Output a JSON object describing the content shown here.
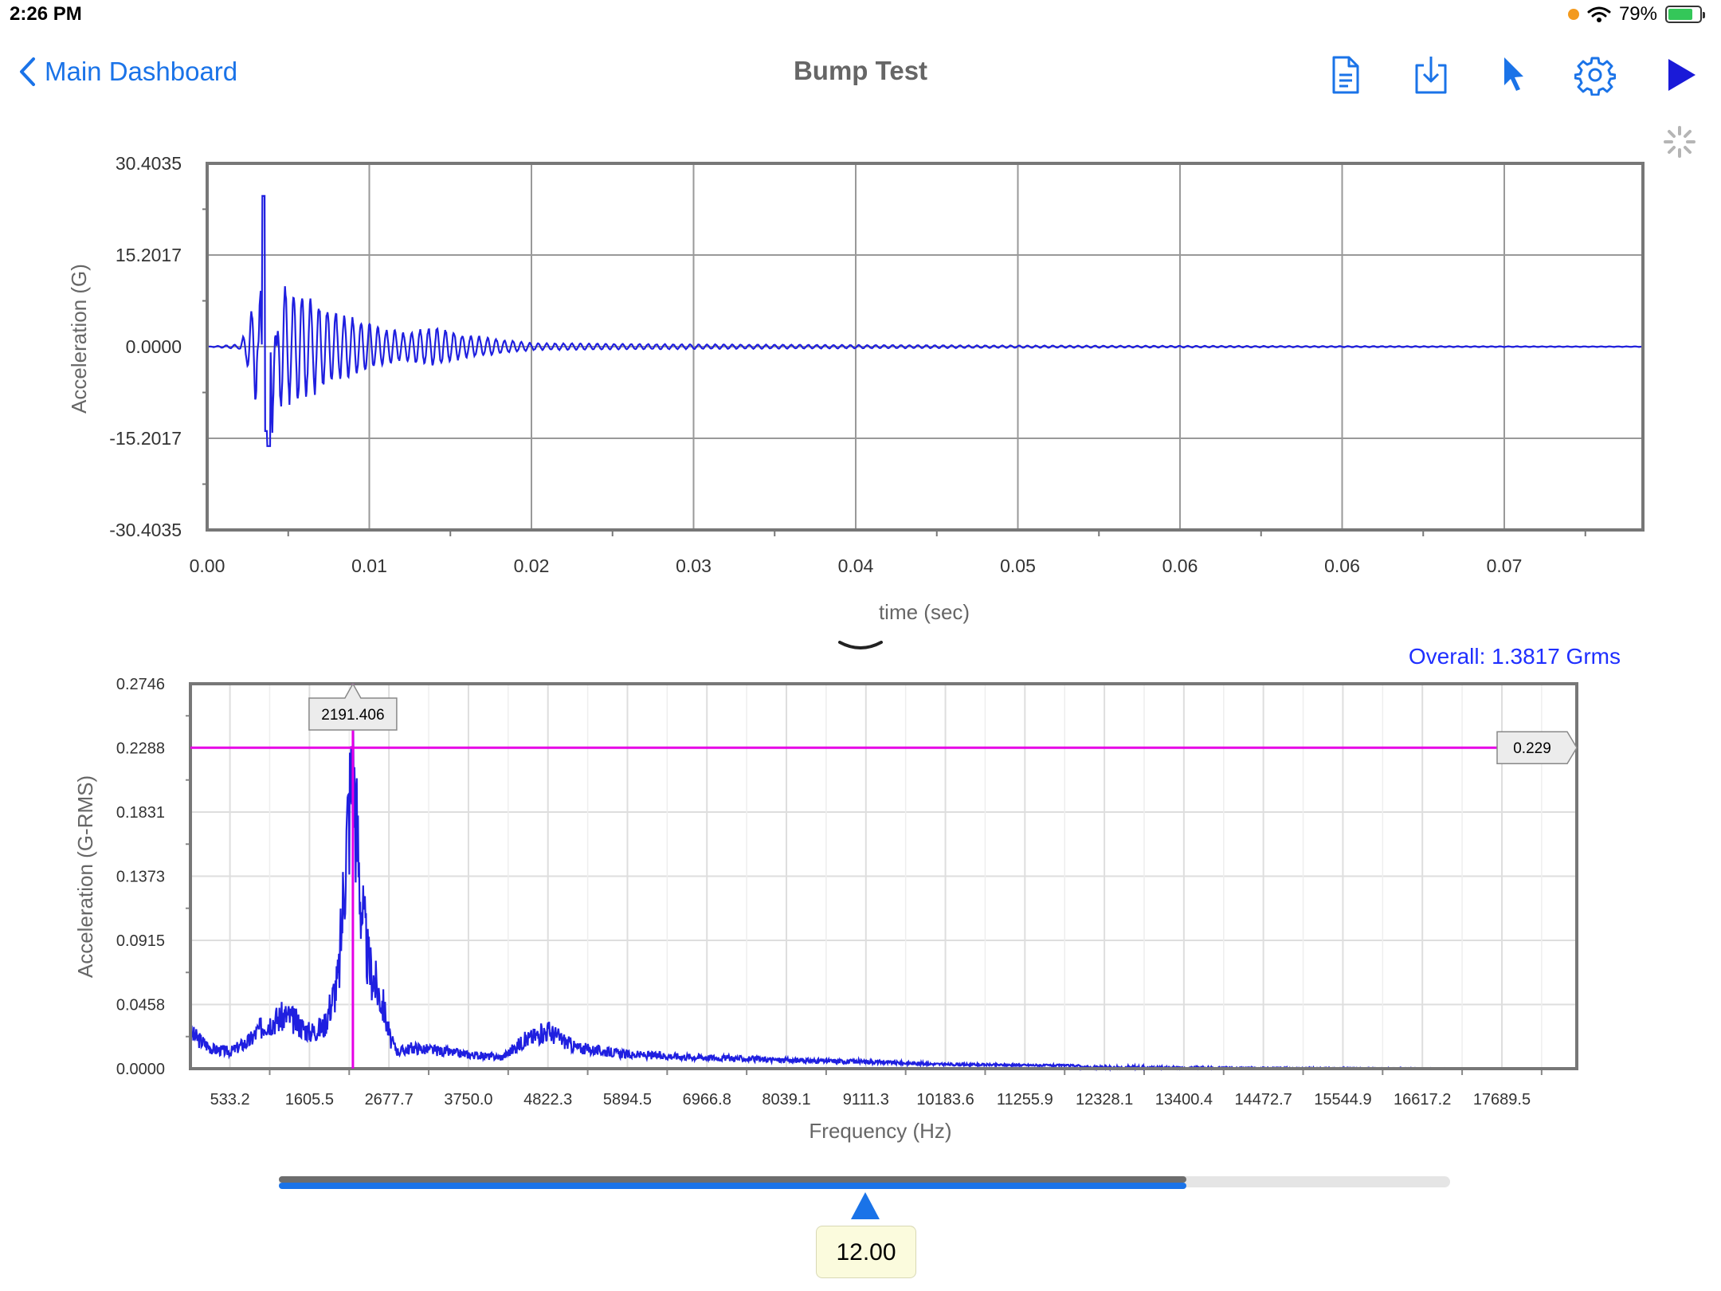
{
  "status_bar": {
    "time": "2:26 PM",
    "battery": "79%",
    "battery_level": 0.79
  },
  "nav": {
    "back_label": "Main Dashboard",
    "title": "Bump Test",
    "icons": [
      "document-icon",
      "download-icon",
      "pointer-icon",
      "settings-icon",
      "play-icon"
    ],
    "accent_color": "#1a73e8"
  },
  "time_chart": {
    "y_ticks": [
      "30.4035",
      "15.2017",
      "0.0000",
      "-15.2017",
      "-30.4035"
    ],
    "x_ticks": [
      "0.00",
      "0.01",
      "0.02",
      "0.03",
      "0.04",
      "0.05",
      "0.06",
      "0.06",
      "0.07"
    ],
    "ylabel": "Acceleration (G)",
    "xlabel": "time (sec)"
  },
  "fft_chart": {
    "overall": "Overall: 1.3817 Grms",
    "y_ticks": [
      "0.2746",
      "0.2288",
      "0.1831",
      "0.1373",
      "0.0915",
      "0.0458",
      "0.0000"
    ],
    "x_ticks": [
      "533.2",
      "1605.5",
      "2677.7",
      "3750.0",
      "4822.3",
      "5894.5",
      "6966.8",
      "8039.1",
      "9111.3",
      "10183.6",
      "11255.9",
      "12328.1",
      "13400.4",
      "14472.7",
      "15544.9",
      "16617.2",
      "17689.5"
    ],
    "ylabel": "Acceleration (G-RMS)",
    "xlabel": "Frequency (Hz)",
    "cursor_x_label": "2191.406",
    "cursor_y_label": "0.229",
    "cursor_color": "#e600e6",
    "line_color": "#1f1fe0"
  },
  "chart_data": [
    {
      "type": "line",
      "title": "",
      "xlabel": "time (sec)",
      "ylabel": "Acceleration (G)",
      "ylim": [
        -30.4035,
        30.4035
      ],
      "xlim": [
        0,
        0.0885
      ],
      "grid": true,
      "series": [
        {
          "x": [
            0.0,
            0.002,
            0.0025,
            0.003,
            0.0033,
            0.0036,
            0.004,
            0.0045,
            0.005,
            0.006,
            0.007,
            0.008,
            0.01,
            0.012,
            0.014,
            0.016,
            0.02,
            0.03,
            0.04,
            0.05,
            0.06,
            0.07,
            0.088
          ],
          "y": [
            0.0,
            0.4,
            3.5,
            10.5,
            -12.0,
            25.0,
            -16.0,
            12.0,
            10.0,
            9.0,
            7.5,
            6.0,
            4.0,
            2.5,
            3.5,
            2.0,
            0.6,
            0.4,
            0.3,
            0.2,
            0.15,
            0.1,
            0.05
          ]
        }
      ]
    },
    {
      "type": "line",
      "title": "",
      "xlabel": "Frequency (Hz)",
      "ylabel": "Acceleration (G-RMS)",
      "ylim": [
        0,
        0.2746
      ],
      "xlim": [
        0,
        18700
      ],
      "grid": true,
      "series": [
        {
          "x": [
            0,
            300,
            533.2,
            800,
            1000,
            1300,
            1605.5,
            1800,
            2000,
            2100,
            2191.406,
            2300,
            2400,
            2500,
            2600,
            2700,
            2800,
            3000,
            3750,
            4200,
            4500,
            4822.3,
            5200,
            5894.5,
            6966.8,
            8039.1,
            9111.3,
            10183.6,
            12328.1,
            14472.7,
            18700
          ],
          "y": [
            0.025,
            0.014,
            0.012,
            0.02,
            0.032,
            0.038,
            0.026,
            0.03,
            0.065,
            0.16,
            0.218,
            0.12,
            0.075,
            0.06,
            0.045,
            0.02,
            0.012,
            0.015,
            0.01,
            0.008,
            0.02,
            0.027,
            0.015,
            0.01,
            0.008,
            0.006,
            0.005,
            0.003,
            0.002,
            0.001,
            0.0
          ]
        }
      ]
    }
  ],
  "slider": {
    "value": "12.00",
    "dark_fraction": 0.775,
    "fill_fraction": 0.775
  }
}
